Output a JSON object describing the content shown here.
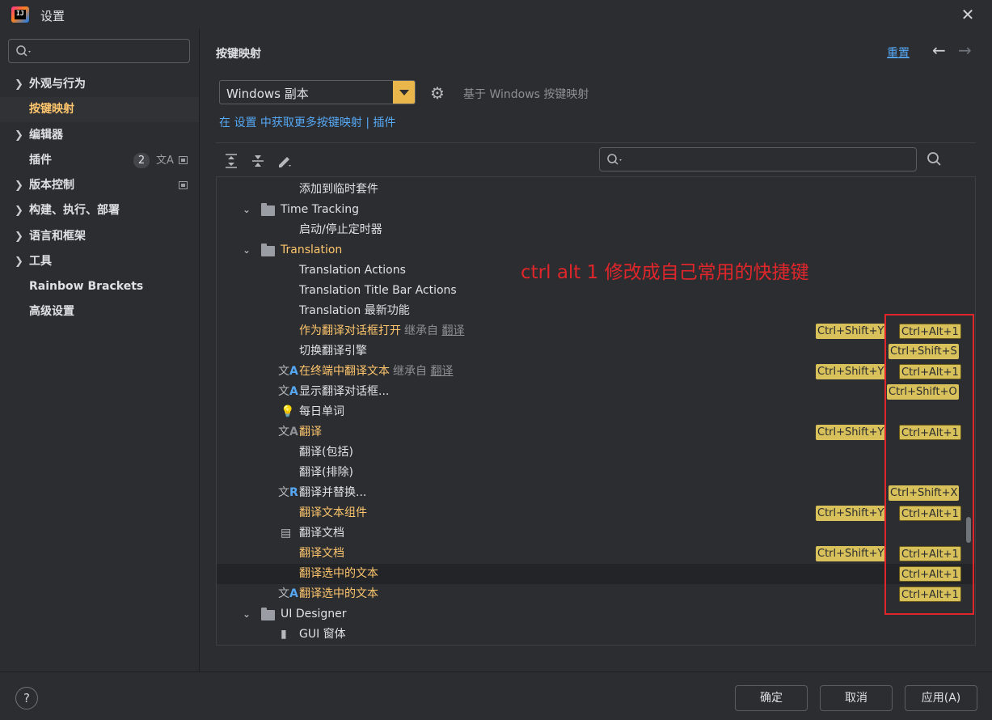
{
  "window": {
    "title": "设置"
  },
  "sidebar": {
    "items": [
      {
        "label": "外观与行为",
        "expandable": true
      },
      {
        "label": "按键映射",
        "expandable": false,
        "selected": true
      },
      {
        "label": "编辑器",
        "expandable": true
      },
      {
        "label": "插件",
        "expandable": false,
        "badge": "2"
      },
      {
        "label": "版本控制",
        "expandable": true
      },
      {
        "label": "构建、执行、部署",
        "expandable": true
      },
      {
        "label": "语言和框架",
        "expandable": true
      },
      {
        "label": "工具",
        "expandable": true
      },
      {
        "label": "Rainbow Brackets",
        "expandable": false
      },
      {
        "label": "高级设置",
        "expandable": false
      }
    ]
  },
  "header": {
    "title": "按键映射",
    "reset": "重置",
    "back": "←",
    "forward": "→"
  },
  "keymap": {
    "selected": "Windows 副本",
    "based_on": "基于 Windows 按键映射",
    "more_prefix": "在 设置 中获取更多按键映射 | ",
    "more_plugins": "插件"
  },
  "tree": {
    "rows": [
      {
        "text": "添加到临时套件",
        "modified": false,
        "keys": []
      },
      {
        "text": "Time Tracking",
        "modified": false,
        "keys": []
      },
      {
        "text": "启动/停止定时器",
        "modified": false,
        "keys": []
      },
      {
        "text": "Translation",
        "modified": true,
        "keys": []
      },
      {
        "text": "Translation Actions",
        "modified": false,
        "keys": []
      },
      {
        "text": "Translation Title Bar Actions",
        "modified": false,
        "keys": []
      },
      {
        "text": "Translation 最新功能",
        "modified": false,
        "keys": []
      },
      {
        "text": "作为翻译对话框打开",
        "modified": true,
        "inherit": "继承自",
        "inherit_link": "翻译",
        "keys": [
          "Ctrl+Shift+Y",
          "Ctrl+Alt+1"
        ]
      },
      {
        "text": "切换翻译引擎",
        "modified": false,
        "keys": [
          "Ctrl+Shift+S"
        ]
      },
      {
        "text": "在终端中翻译文本",
        "modified": true,
        "inherit": "继承自",
        "inherit_link": "翻译",
        "keys": [
          "Ctrl+Shift+Y",
          "Ctrl+Alt+1"
        ]
      },
      {
        "text": "显示翻译对话框...",
        "modified": false,
        "keys": [
          "Ctrl+Shift+O"
        ]
      },
      {
        "text": "每日单词",
        "modified": false,
        "keys": []
      },
      {
        "text": "翻译",
        "modified": true,
        "keys": [
          "Ctrl+Shift+Y",
          "Ctrl+Alt+1"
        ]
      },
      {
        "text": "翻译(包括)",
        "modified": false,
        "keys": []
      },
      {
        "text": "翻译(排除)",
        "modified": false,
        "keys": []
      },
      {
        "text": "翻译并替换...",
        "modified": false,
        "keys": [
          "Ctrl+Shift+X"
        ]
      },
      {
        "text": "翻译文本组件",
        "modified": true,
        "keys": [
          "Ctrl+Shift+Y",
          "Ctrl+Alt+1"
        ]
      },
      {
        "text": "翻译文档",
        "modified": false,
        "keys": []
      },
      {
        "text": "翻译文档",
        "modified": true,
        "keys": [
          "Ctrl+Shift+Y",
          "Ctrl+Alt+1"
        ]
      },
      {
        "text": "翻译选中的文本",
        "modified": true,
        "keys": [
          "Ctrl+Alt+1"
        ]
      },
      {
        "text": "翻译选中的文本",
        "modified": true,
        "keys": [
          "Ctrl+Alt+1"
        ]
      },
      {
        "text": "UI Designer",
        "modified": false,
        "keys": []
      },
      {
        "text": "GUI 窗体",
        "modified": false,
        "keys": []
      }
    ]
  },
  "annotation": "ctrl alt 1  修改成自己常用的快捷键",
  "footer": {
    "help": "?",
    "ok": "确定",
    "cancel": "取消",
    "apply": "应用(A)"
  },
  "colors": {
    "accent": "#e8b64a",
    "modified_text": "#ffc66d",
    "link": "#56a8f5",
    "shortcut_bg": "#d8c05a",
    "annotation": "#e0262b"
  }
}
